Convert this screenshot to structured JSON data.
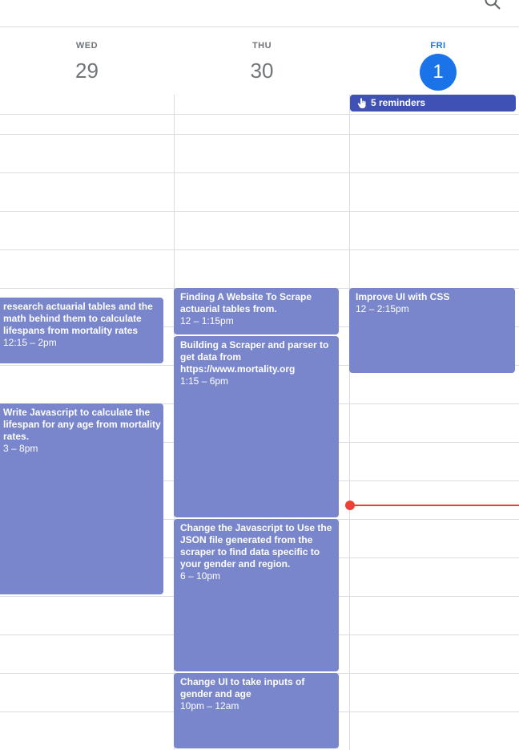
{
  "days": [
    {
      "dow": "WED",
      "num": "29"
    },
    {
      "dow": "THU",
      "num": "30"
    },
    {
      "dow": "FRI",
      "num": "1"
    }
  ],
  "reminders": {
    "label": "5 reminders",
    "icon": "hand-pointer-icon"
  },
  "events": {
    "wed": [
      {
        "title": "research actuarial tables and the math behind them to calculate lifespans from mortality rates",
        "time": "12:15 – 2pm"
      },
      {
        "title": "Write Javascript to calculate the lifespan for any age from mortality rates.",
        "time": "3 – 8pm"
      }
    ],
    "thu": [
      {
        "title": "Finding A Website To Scrape actuarial tables from.",
        "time": "12 – 1:15pm"
      },
      {
        "title": "Building a Scraper and parser to get data from https://www.mortality.org",
        "time": "1:15 – 6pm"
      },
      {
        "title": "Change the Javascript to Use the JSON file generated from the scraper to find data specific to your gender and region.",
        "time": "6 – 10pm"
      },
      {
        "title": "Change UI to take inputs of gender and age",
        "time": "10pm – 12am"
      }
    ],
    "fri": [
      {
        "title": "Improve UI with CSS",
        "time": "12 – 2:15pm"
      }
    ]
  },
  "colors": {
    "event": "#7986cb",
    "reminder": "#3f51b5",
    "today": "#1a73e8",
    "now_indicator": "#ea4335"
  }
}
